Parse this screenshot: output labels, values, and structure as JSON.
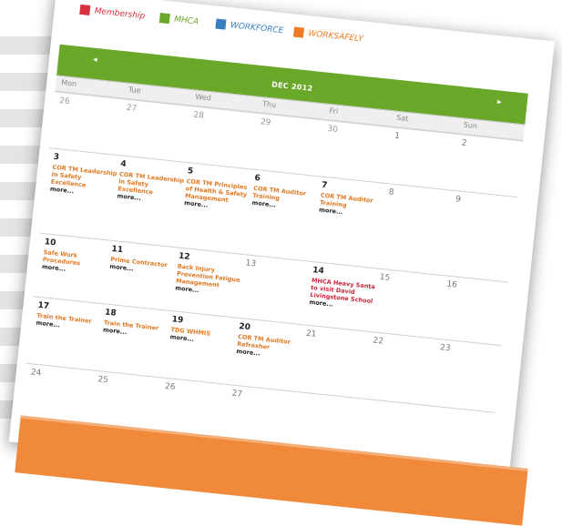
{
  "legend": [
    {
      "label": "Membership",
      "color": "#d8303c"
    },
    {
      "label": "MHCA",
      "color": "#6aa82a"
    },
    {
      "label": "WORKFORCE",
      "color": "#3a7fc0"
    },
    {
      "label": "WORKSAFELY",
      "color": "#f07b26"
    }
  ],
  "nav": {
    "prev": "◂",
    "next": "▸",
    "title": "DEC 2012"
  },
  "days_of_week": [
    "Mon",
    "Tue",
    "Wed",
    "Thu",
    "Fri",
    "Sat",
    "Sun"
  ],
  "more_label": "more...",
  "weeks": [
    [
      {
        "day": "26",
        "muted": true,
        "events": []
      },
      {
        "day": "27",
        "muted": true,
        "events": []
      },
      {
        "day": "28",
        "muted": true,
        "events": []
      },
      {
        "day": "29",
        "muted": true,
        "events": []
      },
      {
        "day": "30",
        "muted": true,
        "events": []
      },
      {
        "day": "1",
        "dim": true,
        "events": []
      },
      {
        "day": "2",
        "dim": true,
        "events": []
      }
    ],
    [
      {
        "day": "3",
        "events": [
          {
            "title": "COR TM Leadership in Safety Excellence"
          }
        ],
        "more": true
      },
      {
        "day": "4",
        "events": [
          {
            "title": "COR TM Leadership in Safety Excellence"
          }
        ],
        "more": true
      },
      {
        "day": "5",
        "events": [
          {
            "title": "COR TM Principles of Health & Safety Management"
          }
        ],
        "more": true
      },
      {
        "day": "6",
        "events": [
          {
            "title": "COR TM Auditor Training"
          }
        ],
        "more": true
      },
      {
        "day": "7",
        "events": [
          {
            "title": "COR TM Auditor Training"
          }
        ],
        "more": true
      },
      {
        "day": "8",
        "dim": true,
        "events": []
      },
      {
        "day": "9",
        "dim": true,
        "events": []
      }
    ],
    [
      {
        "day": "10",
        "events": [
          {
            "title": "Safe Work Procedures"
          }
        ],
        "more": true
      },
      {
        "day": "11",
        "events": [
          {
            "title": "Prime Contractor"
          }
        ],
        "more": true
      },
      {
        "day": "12",
        "events": [
          {
            "title": "Back Injury Prevention Fatigue Management"
          }
        ],
        "more": true
      },
      {
        "day": "13",
        "dim": true,
        "events": []
      },
      {
        "day": "14",
        "events": [
          {
            "title": "MHCA Heavy Santa to visit David Livingstone School",
            "red": true
          }
        ],
        "more": true
      },
      {
        "day": "15",
        "dim": true,
        "events": []
      },
      {
        "day": "16",
        "dim": true,
        "events": []
      }
    ],
    [
      {
        "day": "17",
        "events": [
          {
            "title": "Train the Trainer"
          }
        ],
        "more": true
      },
      {
        "day": "18",
        "events": [
          {
            "title": "Train the Trainer"
          }
        ],
        "more": true
      },
      {
        "day": "19",
        "events": [
          {
            "title": "TDG WHMIS"
          }
        ],
        "more": true
      },
      {
        "day": "20",
        "events": [
          {
            "title": "COR TM Auditor Refresher"
          }
        ],
        "more": true
      },
      {
        "day": "21",
        "dim": true,
        "events": []
      },
      {
        "day": "22",
        "dim": true,
        "events": []
      },
      {
        "day": "23",
        "dim": true,
        "events": []
      }
    ],
    [
      {
        "day": "24",
        "dim": true,
        "events": []
      },
      {
        "day": "25",
        "dim": true,
        "events": []
      },
      {
        "day": "26",
        "dim": true,
        "events": []
      },
      {
        "day": "27",
        "dim": true,
        "events": []
      },
      {
        "day": "",
        "dim": true,
        "events": []
      },
      {
        "day": "",
        "dim": true,
        "events": []
      },
      {
        "day": "",
        "dim": true,
        "events": []
      }
    ]
  ]
}
